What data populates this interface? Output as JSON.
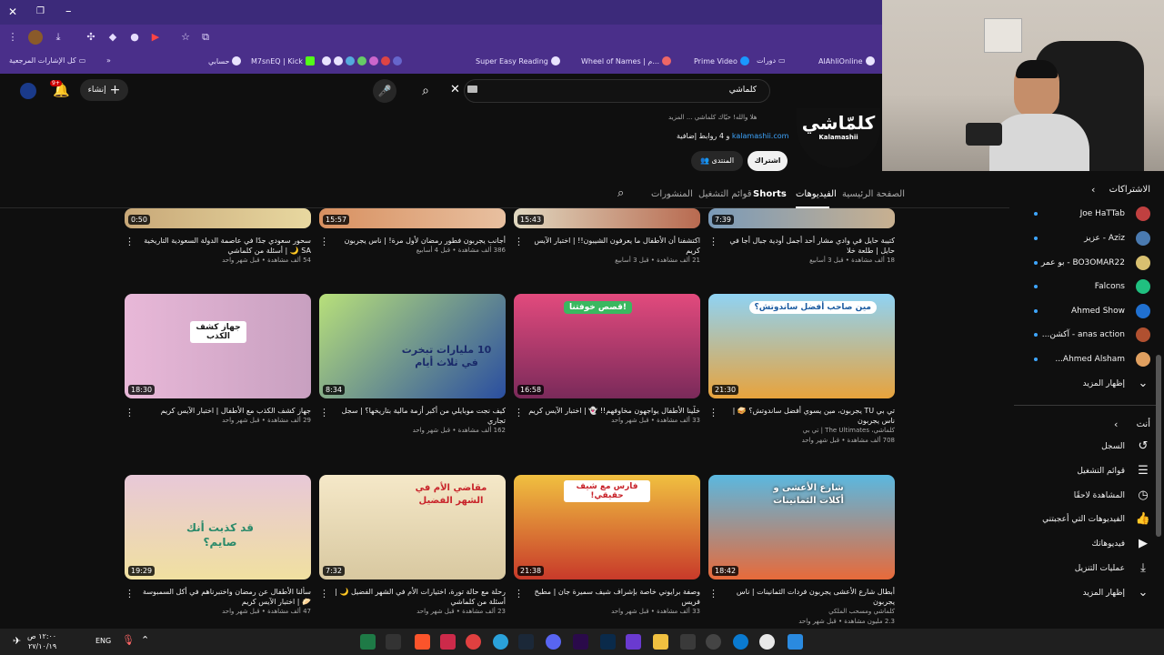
{
  "bookmarks": {
    "all_bookmarks": "كل الإشارات المرجعية",
    "items": [
      "حسابي",
      "M7snEQ | Kick",
      "Super Easy Reading",
      "Wheel of Names | م...",
      "Prime Video",
      "دورات",
      "AlAhliOnline"
    ]
  },
  "header": {
    "search_value": "كلماشي",
    "create_label": "إنشاء",
    "notifications_badge": "9+"
  },
  "channel": {
    "logo_text": "كلمّاشي",
    "logo_sub": "Kalamashii",
    "description": "هلا والله! حيّاك كلماشي ... المزيد",
    "link": "kalamashii.com",
    "more_links": "و 4 روابط إضافية",
    "subscribe": "اشتراك",
    "community": "المنتدى"
  },
  "tabs": [
    "الصفحة الرئيسية",
    "الفيديوهات",
    "Shorts",
    "قوائم التشغيل",
    "المنشورات"
  ],
  "row1": [
    {
      "duration": "7:39",
      "title": "كتيبة حايل في وادي مشار أحد أجمل أودية جبال أجا في حايل | طلعة خلا",
      "meta": "18 ألف مشاهدة • قبل 3 أسابيع"
    },
    {
      "duration": "15:43",
      "title": "اكتشفنا أن الأطفال ما يعرفون الشيبون!! | اختبار الآيس كريم",
      "meta": "21 ألف مشاهدة • قبل 3 أسابيع"
    },
    {
      "duration": "15:57",
      "title": "أجانب يجربون فطور رمضان لأول مرة! | ناس يجربون",
      "meta": "386 ألف مشاهدة • قبل 4 أسابيع"
    },
    {
      "duration": "0:50",
      "title": "سحور سعودي جدًا في عاصمة الدولة السعودية التاريخية SA 🌙 | أسئلة من كلماشي",
      "meta": "54 ألف مشاهدة • قبل شهر واحد"
    }
  ],
  "row2": [
    {
      "duration": "21:30",
      "title": "تي بي TU يجربون، مين يسوي أفضل ساندوتش؟ 🥪 | ناس يجربون",
      "channel": "كلماشي، The Ultimates | تي بي",
      "meta": "708 ألف مشاهدة • قبل شهر واحد",
      "thumb_text": "مين صاحب أفضل ساندوتش؟",
      "colors": [
        "#8fd3f4",
        "#e8a33c"
      ]
    },
    {
      "duration": "16:58",
      "title": "خلّينا الأطفال يواجهون مخاوفهم!! 👻 | اختبار الآيس كريم",
      "meta": "33 ألف مشاهدة • قبل شهر واحد",
      "thumb_text": "قصص خوفتنا!",
      "colors": [
        "#e24a7d",
        "#7a2a5a"
      ]
    },
    {
      "duration": "8:34",
      "title": "كيف نجت موبايلي من أكبر أزمة مالية بتاريخها؟ | سجل تجاري",
      "meta": "162 ألف مشاهدة • قبل شهر واحد",
      "thumb_text": "10 مليارات تبخرت في ثلاث أيام",
      "colors": [
        "#b8e07a",
        "#2a4ea0"
      ]
    },
    {
      "duration": "18:30",
      "title": "جهاز كشف الكذب مع الأطفال | اختبار الآيس كريم",
      "meta": "29 ألف مشاهدة • قبل شهر واحد",
      "thumb_text": "جهاز كشف الكذب",
      "colors": [
        "#e8b8d8",
        "#c8a0c0"
      ]
    }
  ],
  "row3": [
    {
      "duration": "18:42",
      "title": "أبطال شارع الأعشى يجربون فردات الثمانينات | ناس يجربون",
      "channel": "كلماشي ومسحب الملكي",
      "meta": "2.3 مليون مشاهدة • قبل شهر واحد",
      "thumb_text": "شارع الأعشى و أكلات الثمانينات",
      "colors": [
        "#5ab8e0",
        "#e86a3a"
      ]
    },
    {
      "duration": "21:38",
      "title": "وصفة برايوني خاصة بإشراف شيف سميرة جان | مطبخ فريس",
      "meta": "33 ألف مشاهدة • قبل شهر واحد",
      "thumb_text": "فارس مع شيف حقيقي!",
      "colors": [
        "#f0c040",
        "#c83a2a"
      ]
    },
    {
      "duration": "7:32",
      "title": "رحلة مع حالة تورة، اختيارات الأم في الشهر الفضيل 🌙 | أسئلة من كلماشي",
      "meta": "23 ألف مشاهدة • قبل شهر واحد",
      "thumb_text": "مقاضي الأم في الشهر الفضيل",
      "colors": [
        "#f5e8c8",
        "#c84a3a"
      ]
    },
    {
      "duration": "19:29",
      "title": "سألنا الأطفال عن رمضان واختبرناهم في أكل السمبوسة 🥟 | اختبار الآيس كريم",
      "meta": "47 ألف مشاهدة • قبل شهر واحد",
      "thumb_text": "قد كذبت أنك صايم؟",
      "colors": [
        "#e8c8d8",
        "#f0e0a0"
      ]
    }
  ],
  "sidebar": {
    "subscriptions_title": "الاشتراكات",
    "subs": [
      {
        "name": "Joe HaTTab",
        "color": "#c04040"
      },
      {
        "name": "Aziz - عزيز",
        "color": "#4a7ab0"
      },
      {
        "name": "BO3OMAR22 - بو عمر",
        "color": "#d8c070"
      },
      {
        "name": "Falcons",
        "color": "#20c080"
      },
      {
        "name": "Ahmed Show",
        "color": "#2070d0"
      },
      {
        "name": "anas action - آكشن...",
        "color": "#b05030"
      },
      {
        "name": "Ahmed Alsham...",
        "color": "#e0a060"
      }
    ],
    "show_more": "إظهار المزيد",
    "you_title": "أنت",
    "you_items": [
      {
        "label": "السجل",
        "icon": "history-icon"
      },
      {
        "label": "قوائم التشغيل",
        "icon": "playlist-icon"
      },
      {
        "label": "المشاهدة لاحقًا",
        "icon": "clock-icon"
      },
      {
        "label": "الفيديوهات التي أعجبتني",
        "icon": "like-icon"
      },
      {
        "label": "فيديوهاتك",
        "icon": "video-icon"
      },
      {
        "label": "عمليات التنزيل",
        "icon": "download-icon"
      }
    ],
    "you_more": "إظهار المزيد"
  },
  "taskbar": {
    "lang": "ENG",
    "time": "١٢:٠٠ ص",
    "date": "٢٧/١٠/١٩"
  }
}
